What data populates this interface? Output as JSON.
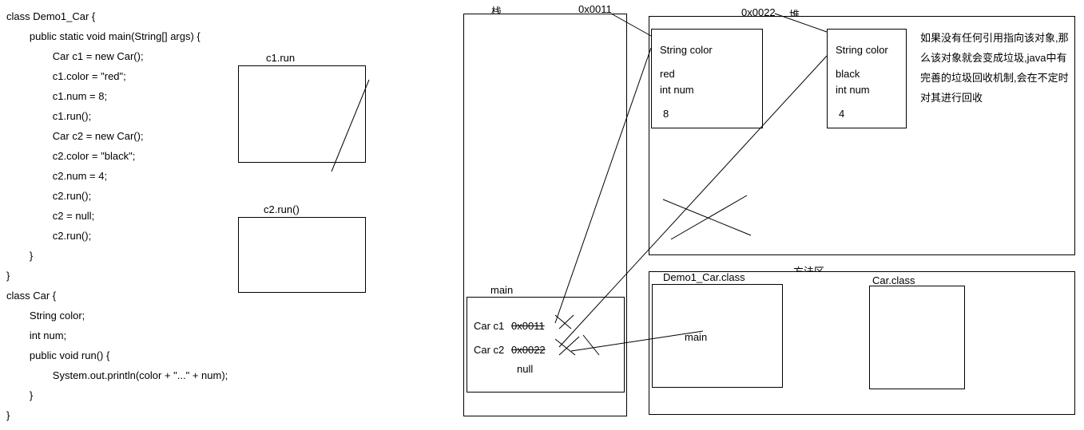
{
  "code": {
    "l1": "class Demo1_Car {",
    "l2": "        public static void main(String[] args) {",
    "l3": "                Car c1 = new Car();",
    "l4": "                c1.color = \"red\";",
    "l5": "                c1.num = 8;",
    "l6": "                c1.run();",
    "l7": "                Car c2 = new Car();",
    "l8": "                c2.color = \"black\";",
    "l9": "                c2.num = 4;",
    "l10": "                c2.run();",
    "l11": "                c2 = null;",
    "l12": "                c2.run();",
    "l13": "        }",
    "l14": "}",
    "l15": "class Car {",
    "l16": "        String color;",
    "l17": "        int num;",
    "l18": "        public void run() {",
    "l19": "                System.out.println(color + \"...\" + num);",
    "l20": "        }",
    "l21": "}"
  },
  "labels": {
    "c1run": "c1.run",
    "c2run": "c2.run()",
    "stack": "栈",
    "heap": "堆",
    "addr1": "0x0011",
    "addr2": "0x0022",
    "method_area": "方法区",
    "main": "main",
    "demo_class": "Demo1_Car.class",
    "car_class": "Car.class"
  },
  "obj1": {
    "field1": "String color",
    "val1": "red",
    "field2": "int num",
    "val2": "8"
  },
  "obj2": {
    "field1": "String color",
    "val1": "black",
    "field2": "int num",
    "val2": "4"
  },
  "stack_frame": {
    "car_c1": "Car c1",
    "car_c2": "Car c2",
    "addr1": "0x0011",
    "addr2": "0x0022",
    "null": "null"
  },
  "note": "如果没有任何引用指向该对象,那么该对象就会变成垃圾,java中有完善的垃圾回收机制,会在不定时对其进行回收",
  "demo_class_content": {
    "main": "main"
  }
}
